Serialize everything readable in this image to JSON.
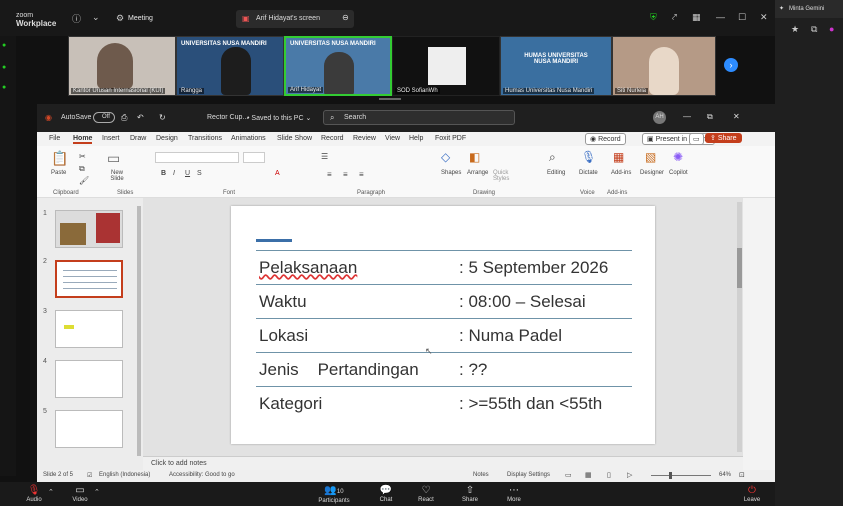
{
  "zoom": {
    "logo_line1": "zoom",
    "logo_line2": "Workplace",
    "meeting_label": "Meeting",
    "share_tab": "Arif Hidayat's screen"
  },
  "right_panel": {
    "title": "Minta Gemini"
  },
  "participants": [
    {
      "name": "Kantor Urusan Internasional (KUI)"
    },
    {
      "name": "Rangga"
    },
    {
      "name": "Arif Hidayat"
    },
    {
      "name": "SOD SofianWh"
    },
    {
      "name": "Humas Universitas Nusa Mandiri"
    },
    {
      "name": "Siti Nurlela"
    }
  ],
  "banner": {
    "univ1": "UNIVERSITAS NUSA MANDIRI",
    "univ2": "UNIVERSITAS NUSA MANDIRI",
    "humas": "HUMAS UNIVERSITAS NUSA MANDIRI"
  },
  "ppt": {
    "autosave": "AutoSave",
    "toggle": "Off",
    "filename": "Rector Cup...",
    "saved": "• Saved to this PC ⌄",
    "search": "Search",
    "user": "AH",
    "tabs": [
      "File",
      "Home",
      "Insert",
      "Draw",
      "Design",
      "Transitions",
      "Animations",
      "Slide Show",
      "Record",
      "Review",
      "View",
      "Help",
      "Foxit PDF"
    ],
    "record_btn": "Record",
    "present_btn": "Present in Teams",
    "share_btn": "Share",
    "groups": {
      "clipboard": "Clipboard",
      "slides": "Slides",
      "font": "Font",
      "paragraph": "Paragraph",
      "drawing": "Drawing",
      "voice": "Voice",
      "addins": "Add-ins"
    },
    "tools": {
      "paste": "Paste",
      "new_slide": "New Slide",
      "shapes": "Shapes",
      "arrange": "Arrange",
      "quick_styles": "Quick Styles",
      "editing": "Editing",
      "dictate": "Dictate",
      "addins": "Add-ins",
      "designer": "Designer",
      "copilot": "Copilot"
    },
    "slide_rows": [
      {
        "key": "Pelaksanaan",
        "val": ": 5 September 2026"
      },
      {
        "key": "Waktu",
        "val": ": 08:00 – Selesai"
      },
      {
        "key": "Lokasi",
        "val": ": Numa Padel"
      },
      {
        "key": "Jenis    Pertandingan",
        "val": ": ??"
      },
      {
        "key": "Kategori",
        "val": ": >=55th dan <55th"
      }
    ],
    "notes": "Click to add notes",
    "status_slide": "Slide 2 of 5",
    "status_lang": "English (Indonesia)",
    "status_access": "Accessibility: Good to go",
    "status_notes": "Notes",
    "status_display": "Display Settings",
    "zoom_pct": "64%"
  },
  "bottom": {
    "audio": "Audio",
    "video": "Video",
    "participants": "Participants",
    "participants_count": "10",
    "chat": "Chat",
    "react": "React",
    "share": "Share",
    "more": "More",
    "leave": "Leave"
  }
}
